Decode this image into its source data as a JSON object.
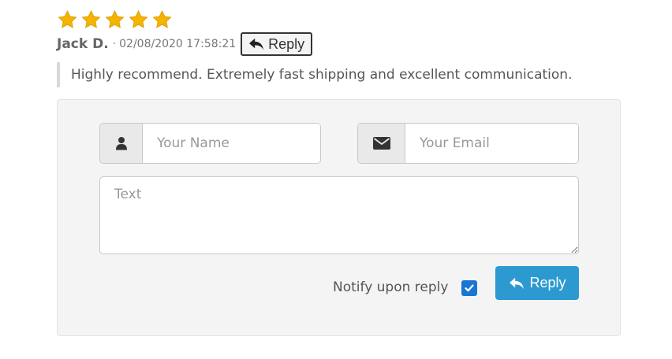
{
  "review": {
    "rating": 5,
    "rating_max": 5,
    "star_color": "#f5b400",
    "author": "Jack D.",
    "separator": "·",
    "date": "02/08/2020 17:58:21",
    "reply_label": "Reply",
    "comment": "Highly recommend. Extremely fast shipping and excellent communication."
  },
  "reply_form": {
    "name_icon": "user-icon",
    "name_placeholder": "Your Name",
    "name_value": "",
    "email_icon": "envelope-icon",
    "email_placeholder": "Your Email",
    "email_value": "",
    "text_placeholder": "Text",
    "text_value": "",
    "notify_label": "Notify upon reply",
    "notify_checked": true,
    "submit_label": "Reply",
    "submit_color": "#2c9ad1"
  }
}
